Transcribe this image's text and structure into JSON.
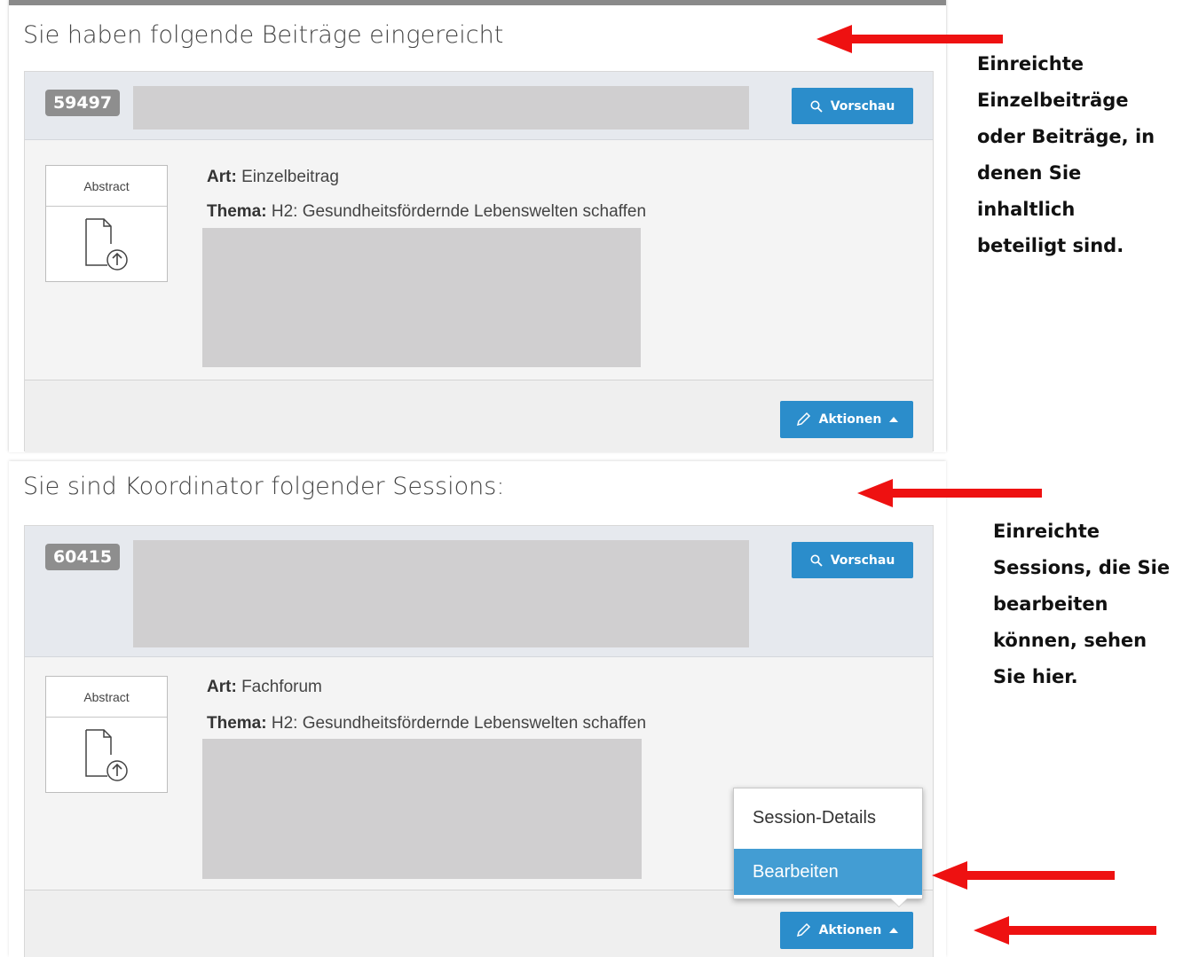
{
  "section_submitted": {
    "title": "Sie haben folgende Beiträge eingereicht",
    "id_badge": "59497",
    "preview_label": "Vorschau",
    "abstract_label": "Abstract",
    "art_label": "Art:",
    "art_value": "Einzelbeitrag",
    "thema_label": "Thema:",
    "thema_value": "H2: Gesundheitsfördernde Lebenswelten schaffen",
    "actions_label": "Aktionen"
  },
  "section_sessions": {
    "title": "Sie sind Koordinator folgender Sessions:",
    "id_badge": "60415",
    "preview_label": "Vorschau",
    "abstract_label": "Abstract",
    "art_label": "Art:",
    "art_value": "Fachforum",
    "thema_label": "Thema:",
    "thema_value": "H2: Gesundheitsfördernde Lebenswelten schaffen",
    "actions_label": "Aktionen",
    "dropdown": {
      "items": [
        "Session-Details",
        "Bearbeiten"
      ],
      "selected": "Bearbeiten"
    }
  },
  "annotations": {
    "note1": [
      "Einreichte",
      "Einzelbeiträge",
      "oder Beiträge, in",
      "denen Sie",
      "inhaltlich",
      "beteiligt sind."
    ],
    "note2": [
      "Einreichte",
      "Sessions, die Sie",
      "bearbeiten",
      "können, sehen",
      "Sie hier."
    ],
    "arrow_color": "#ee1111"
  },
  "colors": {
    "primary_button": "#2b8dcb",
    "dropdown_active": "#439dd3",
    "badge": "#8e8e8e",
    "card_header": "#e6e9ee"
  },
  "icons": [
    "search-icon",
    "pencil-icon",
    "caret-up-icon",
    "file-upload-icon"
  ]
}
